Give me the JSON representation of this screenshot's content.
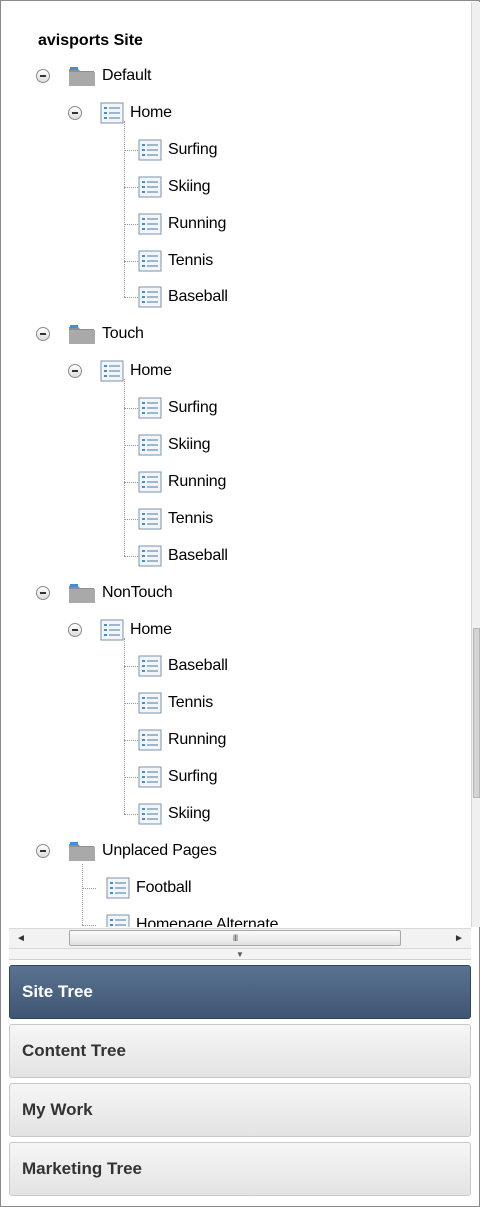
{
  "tree": {
    "title": "avisports Site",
    "sites": [
      {
        "label": "Default",
        "home": "Home",
        "pages": [
          "Surfing",
          "Skiing",
          "Running",
          "Tennis",
          "Baseball"
        ]
      },
      {
        "label": "Touch",
        "home": "Home",
        "pages": [
          "Surfing",
          "Skiing",
          "Running",
          "Tennis",
          "Baseball"
        ]
      },
      {
        "label": "NonTouch",
        "home": "Home",
        "pages": [
          "Baseball",
          "Tennis",
          "Running",
          "Surfing",
          "Skiing"
        ]
      }
    ],
    "unplaced": {
      "label": "Unplaced Pages",
      "pages": [
        "Football",
        "Homepage Alternate"
      ]
    }
  },
  "scrollbar": {
    "thumb_grip": "III",
    "left_arrow": "◄",
    "right_arrow": "►"
  },
  "splitter": {
    "arrow": "▼"
  },
  "accordion": [
    {
      "label": "Site Tree",
      "active": true
    },
    {
      "label": "Content Tree",
      "active": false
    },
    {
      "label": "My Work",
      "active": false
    },
    {
      "label": "Marketing Tree",
      "active": false
    }
  ],
  "colors": {
    "active_panel": "#4a6482",
    "page_icon_accent": "#3f8fd6",
    "folder": "#9a9a9a"
  }
}
